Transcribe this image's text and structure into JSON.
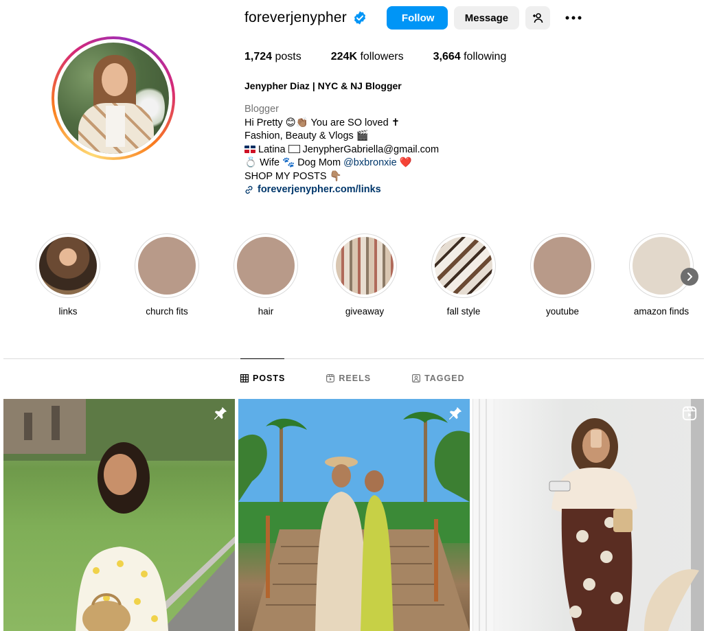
{
  "profile": {
    "username": "foreverjenypher",
    "follow_label": "Follow",
    "message_label": "Message",
    "stats": [
      {
        "value": "1,724",
        "label": "posts"
      },
      {
        "value": "224K",
        "label": "followers"
      },
      {
        "value": "3,664",
        "label": "following"
      }
    ],
    "full_name": "Jenypher Diaz | NYC & NJ Blogger",
    "category": "Blogger",
    "bio_lines": [
      "Hi Pretty 😊👏🏽 You are SO loved ✝",
      "Fashion, Beauty & Vlogs 🎬",
      "Latina",
      "JenypherGabriella@gmail.com",
      "💍 Wife 🐾 Dog Mom",
      "@bxbronxie",
      "❤️",
      "SHOP MY POSTS 👇🏽"
    ],
    "link": "foreverjenypher.com/links"
  },
  "highlights": [
    {
      "label": "links",
      "color": "#6b4a33"
    },
    {
      "label": "church fits",
      "color": "#b89a89"
    },
    {
      "label": "hair",
      "color": "#b89a89"
    },
    {
      "label": "giveaway",
      "color": "#c9b6a3"
    },
    {
      "label": "fall style",
      "color": "#d8cfc5"
    },
    {
      "label": "youtube",
      "color": "#b89a89"
    },
    {
      "label": "amazon finds",
      "color": "#e2d8cb"
    }
  ],
  "tabs": [
    {
      "label": "POSTS",
      "icon": "grid-icon"
    },
    {
      "label": "REELS",
      "icon": "reels-icon"
    },
    {
      "label": "TAGGED",
      "icon": "tagged-icon"
    }
  ],
  "colors": {
    "accent": "#0095f6",
    "link": "#00376b",
    "muted": "#737373"
  }
}
